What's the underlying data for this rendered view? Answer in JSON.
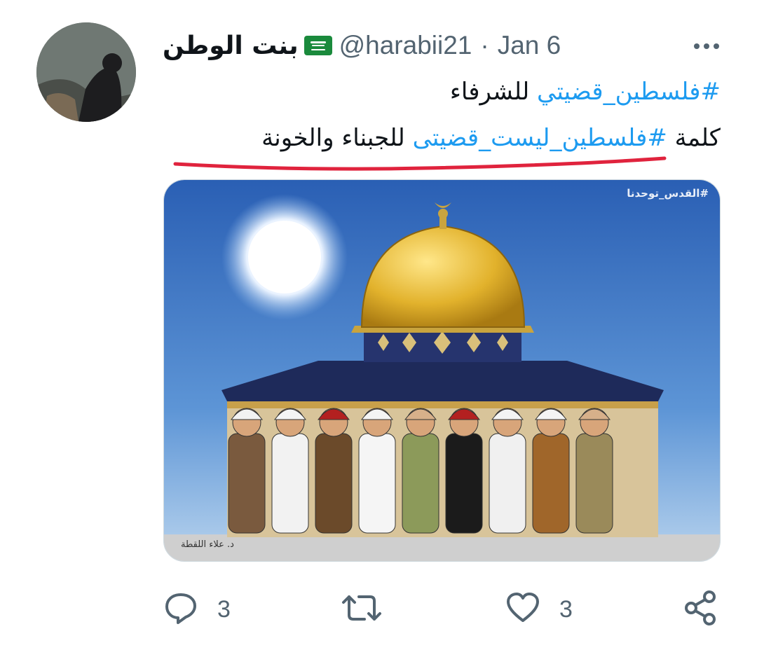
{
  "tweet": {
    "author": {
      "display_name": "بنت الوطن",
      "flag_icon": "saudi-flag-icon",
      "handle": "@harabii21",
      "separator": "·",
      "date": "Jan 6"
    },
    "more_icon": "ellipsis-icon",
    "text": {
      "line1": {
        "hashtag": "#فلسطين_قضيتي",
        "rest": " للشرفاء"
      },
      "line2": {
        "prefix": "كلمة ",
        "hashtag": "#فلسطين_ليست_قضيتى",
        "rest": " للجبناء والخونة"
      }
    },
    "underline_color": "#e0233d",
    "media": {
      "caption": "#القدس_توحدنا",
      "signature": "د. علاء اللقطة"
    },
    "actions": {
      "reply": {
        "icon": "reply-icon",
        "count": "3"
      },
      "retweet": {
        "icon": "retweet-icon",
        "count": ""
      },
      "like": {
        "icon": "heart-icon",
        "count": "3"
      },
      "share": {
        "icon": "share-icon"
      }
    },
    "colors": {
      "link": "#1d9bf0",
      "secondary": "#536471",
      "primary": "#0f1419"
    }
  }
}
